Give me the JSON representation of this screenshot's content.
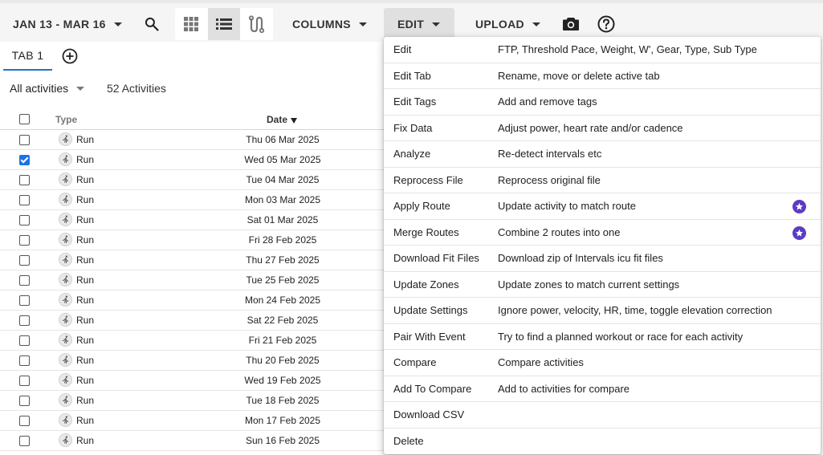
{
  "toolbar": {
    "date_range": "JAN 13 - MAR 16",
    "columns_label": "COLUMNS",
    "edit_label": "EDIT",
    "upload_label": "UPLOAD",
    "icons": [
      "search-icon",
      "grid-view-icon",
      "list-view-icon",
      "route-view-icon",
      "camera-icon",
      "help-icon"
    ]
  },
  "tabs": {
    "items": [
      {
        "label": "TAB 1",
        "active": true
      }
    ],
    "add_icon": "add-circle-icon"
  },
  "filter": {
    "selected": "All activities",
    "count": "52 Activities"
  },
  "table": {
    "headers": {
      "type": "Type",
      "date": "Date"
    },
    "sort": "date-desc",
    "rows": [
      {
        "type": "Run",
        "date": "Thu 06 Mar 2025",
        "checked": false
      },
      {
        "type": "Run",
        "date": "Wed 05 Mar 2025",
        "checked": true
      },
      {
        "type": "Run",
        "date": "Tue 04 Mar 2025",
        "checked": false
      },
      {
        "type": "Run",
        "date": "Mon 03 Mar 2025",
        "checked": false
      },
      {
        "type": "Run",
        "date": "Sat 01 Mar 2025",
        "checked": false
      },
      {
        "type": "Run",
        "date": "Fri 28 Feb 2025",
        "checked": false
      },
      {
        "type": "Run",
        "date": "Thu 27 Feb 2025",
        "checked": false
      },
      {
        "type": "Run",
        "date": "Tue 25 Feb 2025",
        "checked": false
      },
      {
        "type": "Run",
        "date": "Mon 24 Feb 2025",
        "checked": false
      },
      {
        "type": "Run",
        "date": "Sat 22 Feb 2025",
        "checked": false
      },
      {
        "type": "Run",
        "date": "Fri 21 Feb 2025",
        "checked": false
      },
      {
        "type": "Run",
        "date": "Thu 20 Feb 2025",
        "checked": false
      },
      {
        "type": "Run",
        "date": "Wed 19 Feb 2025",
        "checked": false
      },
      {
        "type": "Run",
        "date": "Tue 18 Feb 2025",
        "checked": false
      },
      {
        "type": "Run",
        "date": "Mon 17 Feb 2025",
        "checked": false
      },
      {
        "type": "Run",
        "date": "Sun 16 Feb 2025",
        "checked": false
      }
    ]
  },
  "edit_menu": {
    "items": [
      {
        "label": "Edit",
        "desc": "FTP, Threshold Pace, Weight, W', Gear, Type, Sub Type",
        "premium": false
      },
      {
        "label": "Edit Tab",
        "desc": "Rename, move or delete active tab",
        "premium": false
      },
      {
        "label": "Edit Tags",
        "desc": "Add and remove tags",
        "premium": false
      },
      {
        "label": "Fix Data",
        "desc": "Adjust power, heart rate and/or cadence",
        "premium": false
      },
      {
        "label": "Analyze",
        "desc": "Re-detect intervals etc",
        "premium": false
      },
      {
        "label": "Reprocess File",
        "desc": "Reprocess original file",
        "premium": false
      },
      {
        "label": "Apply Route",
        "desc": "Update activity to match route",
        "premium": true
      },
      {
        "label": "Merge Routes",
        "desc": "Combine 2 routes into one",
        "premium": true
      },
      {
        "label": "Download Fit Files",
        "desc": "Download zip of Intervals icu fit files",
        "premium": false
      },
      {
        "label": "Update Zones",
        "desc": "Update zones to match current settings",
        "premium": false
      },
      {
        "label": "Update Settings",
        "desc": "Ignore power, velocity, HR, time, toggle elevation correction",
        "premium": false
      },
      {
        "label": "Pair With Event",
        "desc": "Try to find a planned workout or race for each activity",
        "premium": false
      },
      {
        "label": "Compare",
        "desc": "Compare activities",
        "premium": false
      },
      {
        "label": "Add To Compare",
        "desc": "Add to activities for compare",
        "premium": false
      },
      {
        "label": "Download CSV",
        "desc": "",
        "premium": false
      },
      {
        "label": "Delete",
        "desc": "",
        "premium": false
      }
    ],
    "premium_icon": "star-badge-icon",
    "premium_color": "#5b3cc4"
  },
  "colors": {
    "accent": "#1976d2",
    "checkbox_checked": "#1a73e8",
    "toolbar_bg": "#f5f5f5"
  }
}
